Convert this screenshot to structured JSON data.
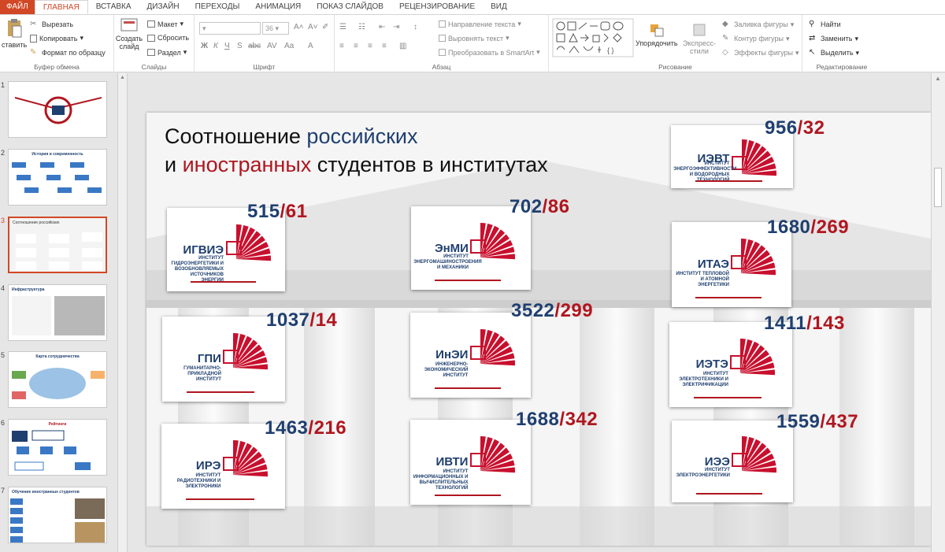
{
  "ribbon": {
    "tabs": [
      "ФАЙЛ",
      "ГЛАВНАЯ",
      "ВСТАВКА",
      "ДИЗАЙН",
      "ПЕРЕХОДЫ",
      "АНИМАЦИЯ",
      "ПОКАЗ СЛАЙДОВ",
      "РЕЦЕНЗИРОВАНИЕ",
      "ВИД"
    ],
    "clipboard": {
      "paste": "ставить",
      "cut": "Вырезать",
      "copy": "Копировать",
      "format": "Формат по образцу",
      "label": "Буфер обмена"
    },
    "slides": {
      "new": "Создать слайд",
      "layout": "Макет",
      "reset": "Сбросить",
      "section": "Раздел",
      "label": "Слайды"
    },
    "font": {
      "size": "36",
      "label": "Шрифт"
    },
    "paragraph": {
      "direction": "Направление текста",
      "align": "Выровнять текст",
      "smartart": "Преобразовать в SmartArt",
      "label": "Абзац"
    },
    "drawing": {
      "arrange": "Упорядочить",
      "styles": "Экспресс-стили",
      "fill": "Заливка фигуры",
      "outline": "Контур фигуры",
      "effects": "Эффекты фигуры",
      "label": "Рисование"
    },
    "editing": {
      "find": "Найти",
      "replace": "Заменить",
      "select": "Выделить",
      "label": "Редактирование"
    }
  },
  "thumbnails": [
    {
      "num": "1",
      "title": ""
    },
    {
      "num": "2",
      "title": "История и современность"
    },
    {
      "num": "3",
      "title": "Соотношение российских"
    },
    {
      "num": "4",
      "title": "Инфраструктура"
    },
    {
      "num": "5",
      "title": "Карта сотрудничества"
    },
    {
      "num": "6",
      "title": "Рейтинги"
    },
    {
      "num": "7",
      "title": "Обучение иностранных студентов"
    }
  ],
  "slide": {
    "title_line1_a": "Соотношение ",
    "title_line1_b": "российских",
    "title_line2_a": "и ",
    "title_line2_b": "иностранных",
    "title_line2_c": " студентов в институтах",
    "institutes": [
      {
        "abbr": "ИГВИЭ",
        "name": "Институт гидроэнергетики и возобновляемых источников энергии",
        "ru": "515",
        "foreign": "61"
      },
      {
        "abbr": "ЭнМИ",
        "name": "Институт энергомашиностроения и механики",
        "ru": "702",
        "foreign": "86"
      },
      {
        "abbr": "ИЭВТ",
        "name": "Институт энергоэффективности и водородных технологий",
        "ru": "956",
        "foreign": "32"
      },
      {
        "abbr": "ИТАЭ",
        "name": "Институт тепловой и атомной энергетики",
        "ru": "1680",
        "foreign": "269"
      },
      {
        "abbr": "ГПИ",
        "name": "Гуманитарно-прикладной институт",
        "ru": "1037",
        "foreign": "14"
      },
      {
        "abbr": "ИнЭИ",
        "name": "Инженерно-экономический институт",
        "ru": "3522",
        "foreign": "299"
      },
      {
        "abbr": "ИЭТЭ",
        "name": "Институт электротехники и электрификации",
        "ru": "1411",
        "foreign": "143"
      },
      {
        "abbr": "ИРЭ",
        "name": "Институт радиотехники и электроники",
        "ru": "1463",
        "foreign": "216"
      },
      {
        "abbr": "ИВТИ",
        "name": "Институт информационных и вычислительных технологий",
        "ru": "1688",
        "foreign": "342"
      },
      {
        "abbr": "ИЭЭ",
        "name": "Институт электроэнергетики",
        "ru": "1559",
        "foreign": "437"
      }
    ]
  }
}
